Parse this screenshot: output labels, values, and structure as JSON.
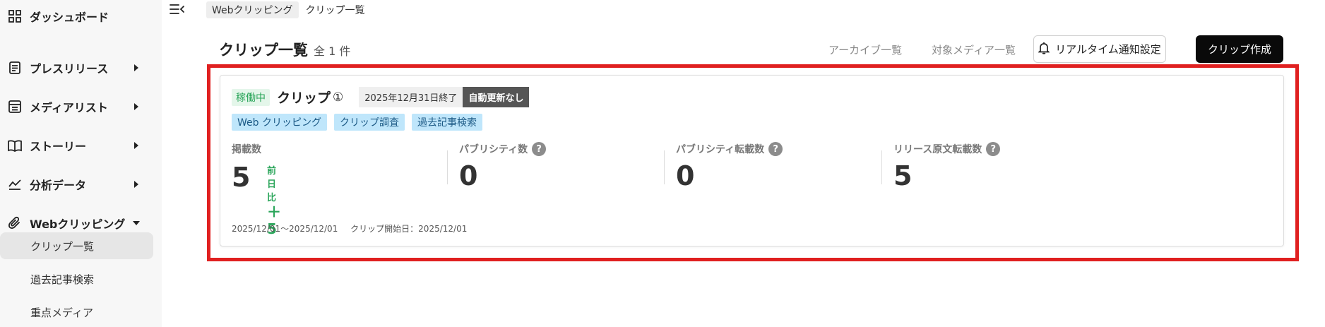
{
  "sidebar": {
    "items": [
      {
        "label": "ダッシュボード",
        "icon": "dashboard-grid-icon",
        "has_arrow": false
      },
      {
        "label": "プレスリリース",
        "icon": "document-icon",
        "has_arrow": true
      },
      {
        "label": "メディアリスト",
        "icon": "list-box-icon",
        "has_arrow": true
      },
      {
        "label": "ストーリー",
        "icon": "book-icon",
        "has_arrow": true
      },
      {
        "label": "分析データ",
        "icon": "chart-line-icon",
        "has_arrow": true
      },
      {
        "label": "Webクリッピング",
        "icon": "paperclip-icon",
        "has_arrow": true,
        "expanded": true
      }
    ],
    "subitems": [
      {
        "label": "クリップ一覧",
        "active": true
      },
      {
        "label": "過去記事検索",
        "active": false
      },
      {
        "label": "重点メディア",
        "active": false
      }
    ]
  },
  "breadcrumb": {
    "chip": "Webクリッピング",
    "current": "クリップ一覧"
  },
  "header": {
    "title": "クリップ一覧",
    "count": "全 1 件",
    "archive_link": "アーカイブ一覧",
    "media_link": "対象メディア一覧",
    "notify_button": "リアルタイム通知設定",
    "create_button": "クリップ作成"
  },
  "card": {
    "status": "稼働中",
    "name": "クリップ",
    "number": "①",
    "end_date": "2025年12月31日終了",
    "auto_update": "自動更新なし",
    "tags": [
      "Web クリッピング",
      "クリップ調査",
      "過去記事検索"
    ],
    "stats": [
      {
        "label": "掲載数",
        "value": "5",
        "help": false,
        "delta_label": "前日比",
        "delta_value": "＋5"
      },
      {
        "label": "パブリシティ数",
        "value": "0",
        "help": true
      },
      {
        "label": "パブリシティ転載数",
        "value": "0",
        "help": true
      },
      {
        "label": "リリース原文転載数",
        "value": "5",
        "help": true
      }
    ],
    "period": "2025/12/01〜2025/12/01",
    "start_label": "クリップ開始日：2025/12/01"
  },
  "colors": {
    "highlight": "#e02020",
    "accent_green": "#2aa55a",
    "tag_bg": "#bfe6fb",
    "dark_button": "#0a0a0a"
  }
}
